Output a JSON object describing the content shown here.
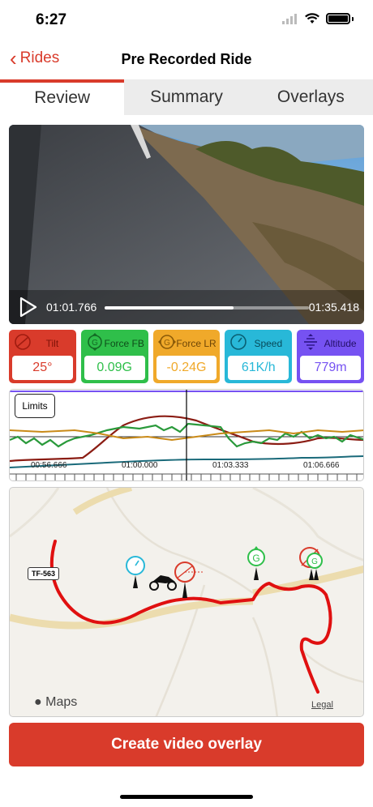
{
  "status_bar": {
    "time": "6:27"
  },
  "nav": {
    "back_label": "Rides",
    "title": "Pre Recorded Ride"
  },
  "tabs": [
    {
      "label": "Review",
      "active": true
    },
    {
      "label": "Summary",
      "active": false
    },
    {
      "label": "Overlays",
      "active": false
    }
  ],
  "video": {
    "current_time": "01:01.766",
    "end_time": "01:35.418",
    "progress": 0.63
  },
  "metrics": [
    {
      "label": "Tilt",
      "value": "25°",
      "color": "#d93b2b",
      "icon": "tilt-icon"
    },
    {
      "label": "Force FB",
      "value": "0.09G",
      "color": "#2fbf4a",
      "icon": "g-force-icon"
    },
    {
      "label": "Force LR",
      "value": "-0.24G",
      "color": "#f0a92a",
      "icon": "g-force-icon"
    },
    {
      "label": "Speed",
      "value": "61K/h",
      "color": "#28b8d8",
      "icon": "speedometer-icon"
    },
    {
      "label": "Altitude",
      "value": "779m",
      "color": "#7652f2",
      "icon": "altitude-icon"
    }
  ],
  "graph": {
    "limits_label": "Limits",
    "time_labels": [
      "00:56.666",
      "01:00.000",
      "01:03.333",
      "01:06.666"
    ]
  },
  "map": {
    "road_label": "TF-563",
    "maps_label": "Maps",
    "legal_label": "Legal"
  },
  "action": {
    "create_label": "Create video overlay"
  }
}
